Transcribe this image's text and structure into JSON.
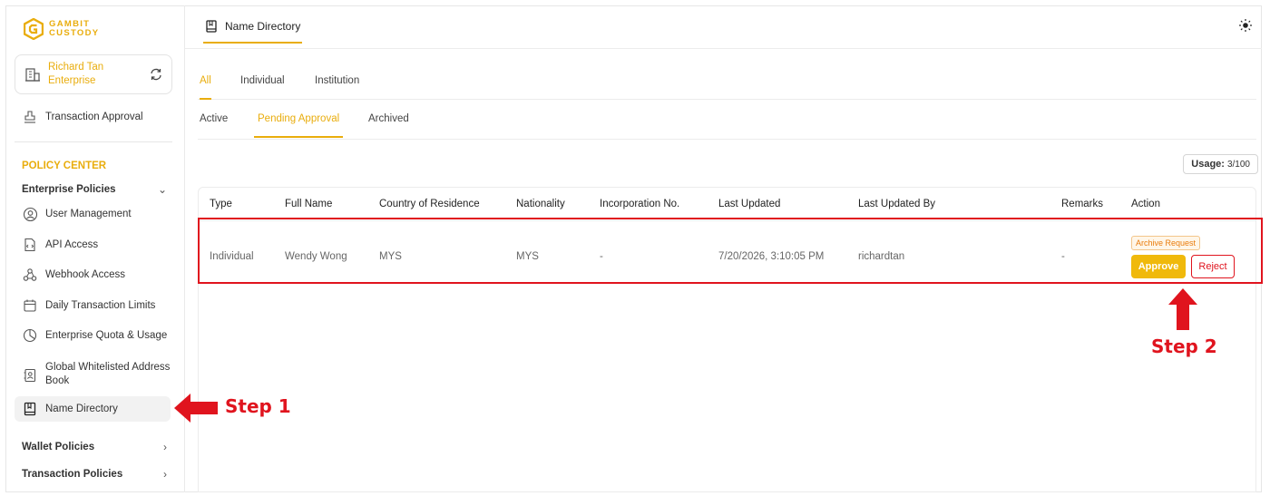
{
  "brand": {
    "line1": "GAMBIT",
    "line2": "CUSTODY",
    "accent": "#e9ad0d"
  },
  "enterprise": {
    "name": "Richard Tan Enterprise"
  },
  "sidebar": {
    "transaction_approval": "Transaction Approval",
    "section": "POLICY CENTER",
    "enterprise_policies": "Enterprise Policies",
    "items": [
      {
        "label": "User Management",
        "icon": "user-gear-icon"
      },
      {
        "label": "API Access",
        "icon": "api-file-icon"
      },
      {
        "label": "Webhook Access",
        "icon": "webhook-icon"
      },
      {
        "label": "Daily Transaction Limits",
        "icon": "calendar-icon"
      },
      {
        "label": "Enterprise Quota & Usage",
        "icon": "pie-chart-icon"
      },
      {
        "label": "Global Whitelisted Address Book",
        "icon": "address-book-icon"
      },
      {
        "label": "Name Directory",
        "icon": "book-icon"
      }
    ],
    "wallet_policies": "Wallet Policies",
    "transaction_policies": "Transaction Policies"
  },
  "topbar": {
    "tab": "Name Directory"
  },
  "tabs_type": [
    "All",
    "Individual",
    "Institution"
  ],
  "tabs_status": [
    "Active",
    "Pending Approval",
    "Archived"
  ],
  "usage": {
    "label": "Usage:",
    "value": "3/100"
  },
  "table": {
    "headers": [
      "Type",
      "Full Name",
      "Country of Residence",
      "Nationality",
      "Incorporation No.",
      "Last Updated",
      "Last Updated By",
      "Remarks",
      "Action"
    ],
    "rows": [
      {
        "type": "Individual",
        "full_name": "Wendy Wong",
        "country": "MYS",
        "nationality": "MYS",
        "incorporation": "-",
        "last_updated": "7/20/2026, 3:10:05 PM",
        "updated_by": "richardtan",
        "remarks": "-",
        "tag": "Archive Request",
        "approve": "Approve",
        "reject": "Reject"
      }
    ]
  },
  "annotations": {
    "step1": "Step 1",
    "step2": "Step 2",
    "color": "#e0141e"
  }
}
